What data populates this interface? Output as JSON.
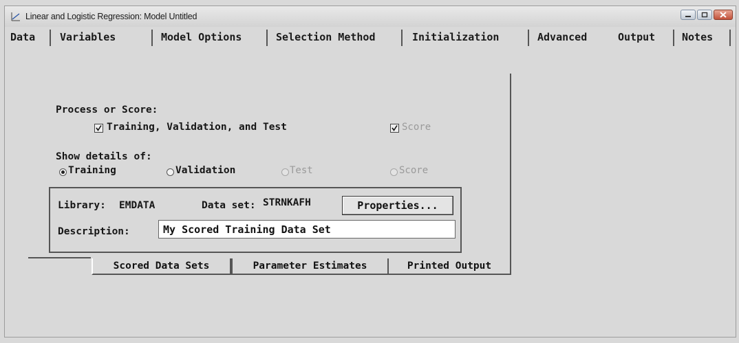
{
  "window": {
    "title": "Linear and Logistic Regression: Model Untitled"
  },
  "tabs_top": [
    "Data",
    "Variables",
    "Model Options",
    "Selection Method",
    "Initialization",
    "Advanced",
    "Output",
    "Notes"
  ],
  "process": {
    "label": "Process or Score:",
    "training_checkbox": {
      "label": "Training, Validation, and Test",
      "checked": true
    },
    "score_checkbox": {
      "label": "Score",
      "checked": true,
      "enabled": false
    }
  },
  "details": {
    "label": "Show details of:",
    "options": [
      {
        "label": "Training",
        "selected": true,
        "enabled": true
      },
      {
        "label": "Validation",
        "selected": false,
        "enabled": true
      },
      {
        "label": "Test",
        "selected": false,
        "enabled": false
      },
      {
        "label": "Score",
        "selected": false,
        "enabled": false
      }
    ]
  },
  "dataset": {
    "library_label": "Library:",
    "library_value": "EMDATA",
    "dataset_label": "Data set:",
    "dataset_value": "STRNKAFH",
    "properties_button": "Properties...",
    "description_label": "Description:",
    "description_value": "My Scored Training Data Set"
  },
  "bottom_tabs": [
    "Scored Data Sets",
    "Parameter Estimates",
    "Printed Output"
  ],
  "icons": {
    "app": "regression-icon",
    "minimize": "minimize-icon",
    "maximize": "maximize-icon",
    "close": "close-icon"
  }
}
